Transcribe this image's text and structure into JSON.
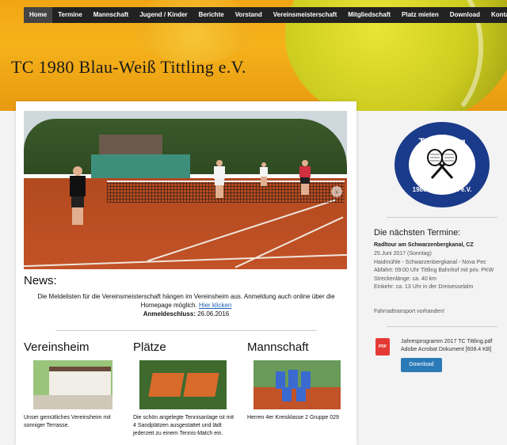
{
  "nav": [
    "Home",
    "Termine",
    "Mannschaft",
    "Jugend / Kinder",
    "Berichte",
    "Vorstand",
    "Vereinsmeisterschaft",
    "Mitgliedschaft",
    "Platz mieten",
    "Download",
    "Kontakt"
  ],
  "site_title": "TC 1980 Blau-Weiß Tittling e.V.",
  "news": {
    "heading": "News:",
    "text": "Die Meldelisten für die Vereinsmeisterschaft hängen im Vereinsheim aus. Anmeldung auch online über die Homepage möglich.",
    "link": "Hier klicken",
    "deadline_label": "Anmeldeschluss:",
    "deadline_value": "26.06.2016"
  },
  "columns": [
    {
      "title": "Vereinsheim",
      "text": "Unser gemütliches Vereinsheim mit sonniger Terrasse."
    },
    {
      "title": "Plätze",
      "text": "Die schön angelegte Tennisanlage ist mit 4 Sandplätzen ausgestattet und lädt jederzeit zu einem Tennis-Match ein."
    },
    {
      "title": "Mannschaft",
      "text": "Herren 4er Kreisklasse 2 Gruppe 029"
    }
  ],
  "logo": {
    "top": "TC Tittling",
    "bottom": "1980 Blau-Weiß e.V."
  },
  "sidebar": {
    "heading": "Die nächsten Termine:",
    "event_title": "Radltour am Schwarzenbergkanal, CZ",
    "event_lines": [
      "25.Juni 2017 (Sonntag)",
      "Haidmühle - Schwarzenbergkanal - Nova Pec",
      "Abfahrt: 09:00 Uhr Tittling Bahnhof mit priv. PKW",
      "Streckenlänge: ca. 40 km",
      "Einkehr: ca. 13 Uhr in der Dreisesselalm"
    ],
    "transport": "Fahrradtransport vorhanden!",
    "file_name": "Jahresprogramm 2017 TC Tittling.pdf",
    "file_meta": "Adobe Acrobat Dokument [608.4 KB]",
    "download_label": "Download",
    "pdf_icon_text": "PDF"
  },
  "colors": {
    "accent": "#2a7ab8",
    "nav_bg": "#222222",
    "header": "#f2a514",
    "logo_blue": "#1a3a8a"
  }
}
